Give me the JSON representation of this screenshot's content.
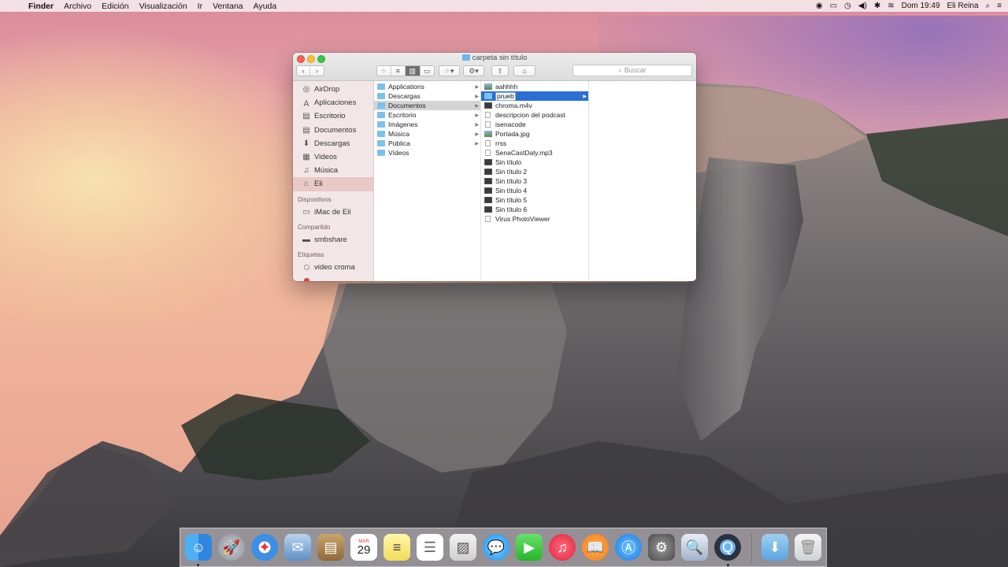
{
  "menubar": {
    "apple": "",
    "items": [
      "Finder",
      "Archivo",
      "Edición",
      "Visualización",
      "Ir",
      "Ventana",
      "Ayuda"
    ],
    "clock": "Dom 19:49",
    "user": "Eli Reina",
    "status_icons": [
      "record-icon",
      "airplay-icon",
      "time-machine-icon",
      "volume-icon",
      "bluetooth-icon",
      "wifi-icon",
      "user-icon",
      "search-icon",
      "list-icon"
    ]
  },
  "window": {
    "title": "carpeta sin título",
    "search_placeholder": "Buscar"
  },
  "sidebar": {
    "favorites": [
      {
        "label": "AirDrop",
        "icon": "airdrop-icon"
      },
      {
        "label": "Aplicaciones",
        "icon": "applications-icon"
      },
      {
        "label": "Escritorio",
        "icon": "desktop-icon"
      },
      {
        "label": "Documentos",
        "icon": "documents-icon"
      },
      {
        "label": "Descargas",
        "icon": "downloads-icon"
      },
      {
        "label": "Videos",
        "icon": "videos-icon"
      },
      {
        "label": "Música",
        "icon": "music-icon"
      },
      {
        "label": "Eli",
        "icon": "home-icon"
      }
    ],
    "devices_header": "Dispositivos",
    "devices": [
      {
        "label": "iMac de Eli",
        "icon": "imac-icon"
      }
    ],
    "shared_header": "Compartido",
    "shared": [
      {
        "label": "smbshare",
        "icon": "server-icon"
      }
    ],
    "tags_header": "Etiquetas",
    "tags": [
      {
        "label": "video croma",
        "color": "#ffffff"
      }
    ]
  },
  "column1": {
    "items": [
      "Applications",
      "Descargas",
      "Documentos",
      "Escritorio",
      "Imágenes",
      "Música",
      "Pública",
      "Vídeos"
    ]
  },
  "column2": {
    "items": [
      {
        "label": "aahhhh",
        "kind": "img"
      },
      {
        "label": "prueb",
        "kind": "folder"
      },
      {
        "label": "chroma.m4v",
        "kind": "mov"
      },
      {
        "label": "descripcion del podcast",
        "kind": "doc"
      },
      {
        "label": "isenacode",
        "kind": "doc"
      },
      {
        "label": "Portada.jpg",
        "kind": "img"
      },
      {
        "label": "rrss",
        "kind": "doc"
      },
      {
        "label": "SenaCastDaly.mp3",
        "kind": "doc"
      },
      {
        "label": "Sin título",
        "kind": "mov"
      },
      {
        "label": "Sin título 2",
        "kind": "mov"
      },
      {
        "label": "Sin título 3",
        "kind": "mov"
      },
      {
        "label": "Sin título 4",
        "kind": "mov"
      },
      {
        "label": "Sin título 5",
        "kind": "mov"
      },
      {
        "label": "Sin título 6",
        "kind": "mov"
      },
      {
        "label": "Virus PhotoViewer",
        "kind": "doc"
      }
    ]
  },
  "dock": {
    "apps": [
      "finder-icon",
      "launchpad-icon",
      "safari-icon",
      "mail-icon",
      "contacts-icon",
      "calendar-icon",
      "notes-icon",
      "reminders-icon",
      "photos-icon",
      "messages-icon",
      "facetime-icon",
      "itunes-icon",
      "ibooks-icon",
      "app-store-icon",
      "system-preferences-icon",
      "preview-icon",
      "quicktime-icon",
      "downloads-folder-icon",
      "trash-icon"
    ],
    "calendar_month": "MAR",
    "calendar_day": "29"
  }
}
